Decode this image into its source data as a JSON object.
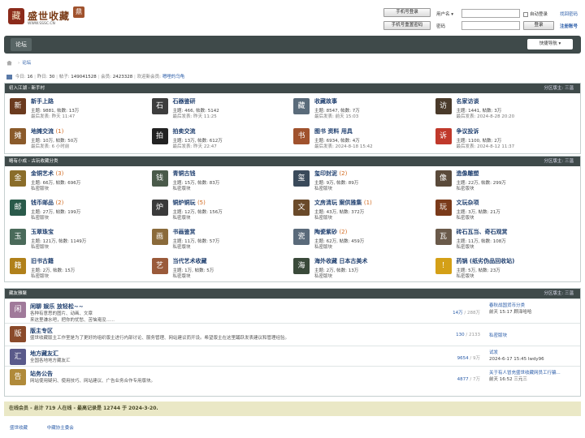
{
  "header": {
    "logo_text": "盛世收藏",
    "logo_url": "WWW.SSSC.CN",
    "logo_seal": "藏",
    "login_button": "手机号登录",
    "reset_button": "手机号重置密码",
    "username_label": "用户名",
    "password_label": "密码",
    "auto_login_label": "自动登录",
    "submit_button": "登录",
    "find_password": "找回密码",
    "register": "注册账号"
  },
  "nav": {
    "forum_label": "论坛",
    "quick_nav": "快捷导航"
  },
  "breadcrumb": {
    "current": "论坛"
  },
  "stats": {
    "today_label": "今日:",
    "today": "16",
    "yesterday_label": "昨日:",
    "yesterday": "30",
    "posts_label": "帖子:",
    "posts": "149041528",
    "members_label": "会员:",
    "members": "2423328",
    "welcome": "欢迎新会员:",
    "new_member": "嗯哩的乌龟"
  },
  "sections": [
    {
      "title": "初入江湖 - 新手村",
      "mods": "分区版主: 三温",
      "forums": [
        {
          "name": "新手上路",
          "new": "",
          "l1": "主题: 9881, 帖数: 13万",
          "l2": "最后发表: 昨天 11:47",
          "icon": "book-icon",
          "color": "#6b3a1e",
          "glyph": "新"
        },
        {
          "name": "石器鉴研",
          "new": "",
          "l1": "主题: 466, 帖数: 5142",
          "l2": "最后发表: 昨天 11:25",
          "icon": "stone-icon",
          "color": "#3d3d3d",
          "glyph": "石"
        },
        {
          "name": "收藏故事",
          "new": "",
          "l1": "主题: 8547, 帖数: 7万",
          "l2": "最后发表: 前天 15:03",
          "icon": "story-icon",
          "color": "#5a6b7a",
          "glyph": "藏"
        },
        {
          "name": "名家访谈",
          "new": "",
          "l1": "主题: 1441, 帖数: 3万",
          "l2": "最后发表: 2024-8-28 20:20",
          "icon": "interview-icon",
          "color": "#4a3a2a",
          "glyph": "访"
        },
        {
          "name": "地摊交流",
          "new": "(1)",
          "l1": "主题: 10万, 帖数: 50万",
          "l2": "最后发表: 6 小时前",
          "icon": "market-icon",
          "color": "#8a5a2a",
          "glyph": "摊"
        },
        {
          "name": "拍卖交流",
          "new": "",
          "l1": "主题: 13万, 帖数: 612万",
          "l2": "最后发表: 昨天 22:47",
          "icon": "auction-icon",
          "color": "#222222",
          "glyph": "拍"
        },
        {
          "name": "图书 资料 用具",
          "new": "",
          "l1": "主题: 6934, 帖数: 4万",
          "l2": "最后发表: 2024-8-18 15:42",
          "icon": "books-icon",
          "color": "#a0522d",
          "glyph": "书"
        },
        {
          "name": "争议投诉",
          "new": "",
          "l1": "主题: 1100, 帖数: 2万",
          "l2": "最后发表: 2024-8-12 11:37",
          "icon": "dispute-icon",
          "color": "#c0392b",
          "glyph": "诉"
        }
      ]
    },
    {
      "title": "略有小成 - 古玩收藏分类",
      "mods": "分区版主: 三温",
      "forums": [
        {
          "name": "金铜艺术",
          "new": "(3)",
          "l1": "主题: 66万, 帖数: 696万",
          "l2": "私密版块",
          "icon": "bronze-icon",
          "color": "#8a6d2a",
          "glyph": "金"
        },
        {
          "name": "青铜古钱",
          "new": "",
          "l1": "主题: 15万, 帖数: 83万",
          "l2": "私密版块",
          "icon": "coin-icon",
          "color": "#4a5a4a",
          "glyph": "钱"
        },
        {
          "name": "玺印封泥",
          "new": "(2)",
          "l1": "主题: 9万, 帖数: 89万",
          "l2": "私密版块",
          "icon": "seal-icon",
          "color": "#3a4a5a",
          "glyph": "玺"
        },
        {
          "name": "造像雕塑",
          "new": "",
          "l1": "主题: 22万, 帖数: 299万",
          "l2": "私密版块",
          "icon": "statue-icon",
          "color": "#5a4a3a",
          "glyph": "像"
        },
        {
          "name": "钱币邮品",
          "new": "(2)",
          "l1": "主题: 27万, 帖数: 199万",
          "l2": "私密版块",
          "icon": "stamp-icon",
          "color": "#2a5a4a",
          "glyph": "邮"
        },
        {
          "name": "铜炉铜玩",
          "new": "(5)",
          "l1": "主题: 12万, 帖数: 156万",
          "l2": "私密版块",
          "icon": "censer-icon",
          "color": "#3a3a3a",
          "glyph": "炉"
        },
        {
          "name": "文房清玩 案供雅集",
          "new": "(1)",
          "l1": "主题: 43万, 帖数: 372万",
          "l2": "私密版块",
          "icon": "study-icon",
          "color": "#6a4a2a",
          "glyph": "文"
        },
        {
          "name": "文玩杂项",
          "new": "",
          "l1": "主题: 3万, 帖数: 21万",
          "l2": "私密版块",
          "icon": "misc-icon",
          "color": "#7a3a1a",
          "glyph": "玩"
        },
        {
          "name": "玉翠珠宝",
          "new": "",
          "l1": "主题: 121万, 帖数: 1149万",
          "l2": "私密版块",
          "icon": "jade-icon",
          "color": "#4a6a5a",
          "glyph": "玉"
        },
        {
          "name": "书画鉴赏",
          "new": "",
          "l1": "主题: 11万, 帖数: 57万",
          "l2": "私密版块",
          "icon": "painting-icon",
          "color": "#8a6a3a",
          "glyph": "画"
        },
        {
          "name": "陶瓷紫砂",
          "new": "(2)",
          "l1": "主题: 62万, 帖数: 459万",
          "l2": "私密版块",
          "icon": "porcelain-icon",
          "color": "#5a6a7a",
          "glyph": "瓷"
        },
        {
          "name": "砖石瓦当、奇石观赏",
          "new": "",
          "l1": "主题: 11万, 帖数: 108万",
          "l2": "私密版块",
          "icon": "tile-icon",
          "color": "#6a5a4a",
          "glyph": "瓦"
        },
        {
          "name": "旧书古籍",
          "new": "",
          "l1": "主题: 2万, 帖数: 15万",
          "l2": "私密版块",
          "icon": "oldbook-icon",
          "color": "#b0801a",
          "glyph": "籍"
        },
        {
          "name": "当代艺术收藏",
          "new": "",
          "l1": "主题: 1万, 帖数: 5万",
          "l2": "私密版块",
          "icon": "modern-art-icon",
          "color": "#9a5a3a",
          "glyph": "艺"
        },
        {
          "name": "海外收藏 日本古美术",
          "new": "",
          "l1": "主题: 2万, 帖数: 13万",
          "l2": "私密版块",
          "icon": "overseas-icon",
          "color": "#3a4a3a",
          "glyph": "海"
        },
        {
          "name": "药锅 (纸劣伪品回收站)",
          "new": "",
          "l1": "主题: 5万, 帖数: 23万",
          "l2": "私密版块",
          "icon": "warning-icon",
          "color": "#d4a017",
          "glyph": "!"
        }
      ]
    },
    {
      "title": "藏友雅聚",
      "mods": "分区版主: 三温",
      "rows": [
        {
          "name": "闲聊 娱乐 放轻松~~",
          "desc1": "各种有意思的图片、动画、文章",
          "desc2": "来这里谦水吧，把你的忧愁、苦恼淹没......",
          "count": "14万",
          "total": "288万",
          "last1": "春秋战国货币分类",
          "last2": "前天 15:17 顾泽哈哈",
          "icon": "chat-icon",
          "color": "#a07a9a",
          "glyph": "闲"
        },
        {
          "name": "版主专区",
          "desc1": "盛世收藏版主工作室是为了更好的组织版主进行内部讨论、服务管理、网站建议而开设。希望版主在这里踊跃发表建议和管理经验。",
          "desc2": "",
          "count": "130",
          "total": "2133",
          "last1": "私密版块",
          "last2": "",
          "icon": "moderator-icon",
          "color": "#8a4a2a",
          "glyph": "版"
        },
        {
          "name": "地方藏友汇",
          "desc1": "全国各地地方藏友汇",
          "desc2": "",
          "count": "9654",
          "total": "9万",
          "last1": "试发",
          "last2": "2024-6-17 15:45 lwdy96",
          "icon": "local-icon",
          "color": "#5a5a8a",
          "glyph": "汇"
        },
        {
          "name": "站务公告",
          "desc1": "网站使用疑问、使用技巧、网站建议、广告业务合作专用版块。",
          "desc2": "",
          "count": "4877",
          "total": "7万",
          "last1": "关于有人冒充盛世收藏网员工行骗...",
          "last2": "前天 16:52 三元三",
          "icon": "notice-icon",
          "color": "#b08a3a",
          "glyph": "告"
        }
      ]
    }
  ],
  "online": {
    "text": "在线会员 - 总计 719 人在线 - 最高记录是 12744 于 2024-3-20."
  },
  "footer": {
    "link1": "盛世收藏",
    "link2": "中藏协主委会"
  }
}
